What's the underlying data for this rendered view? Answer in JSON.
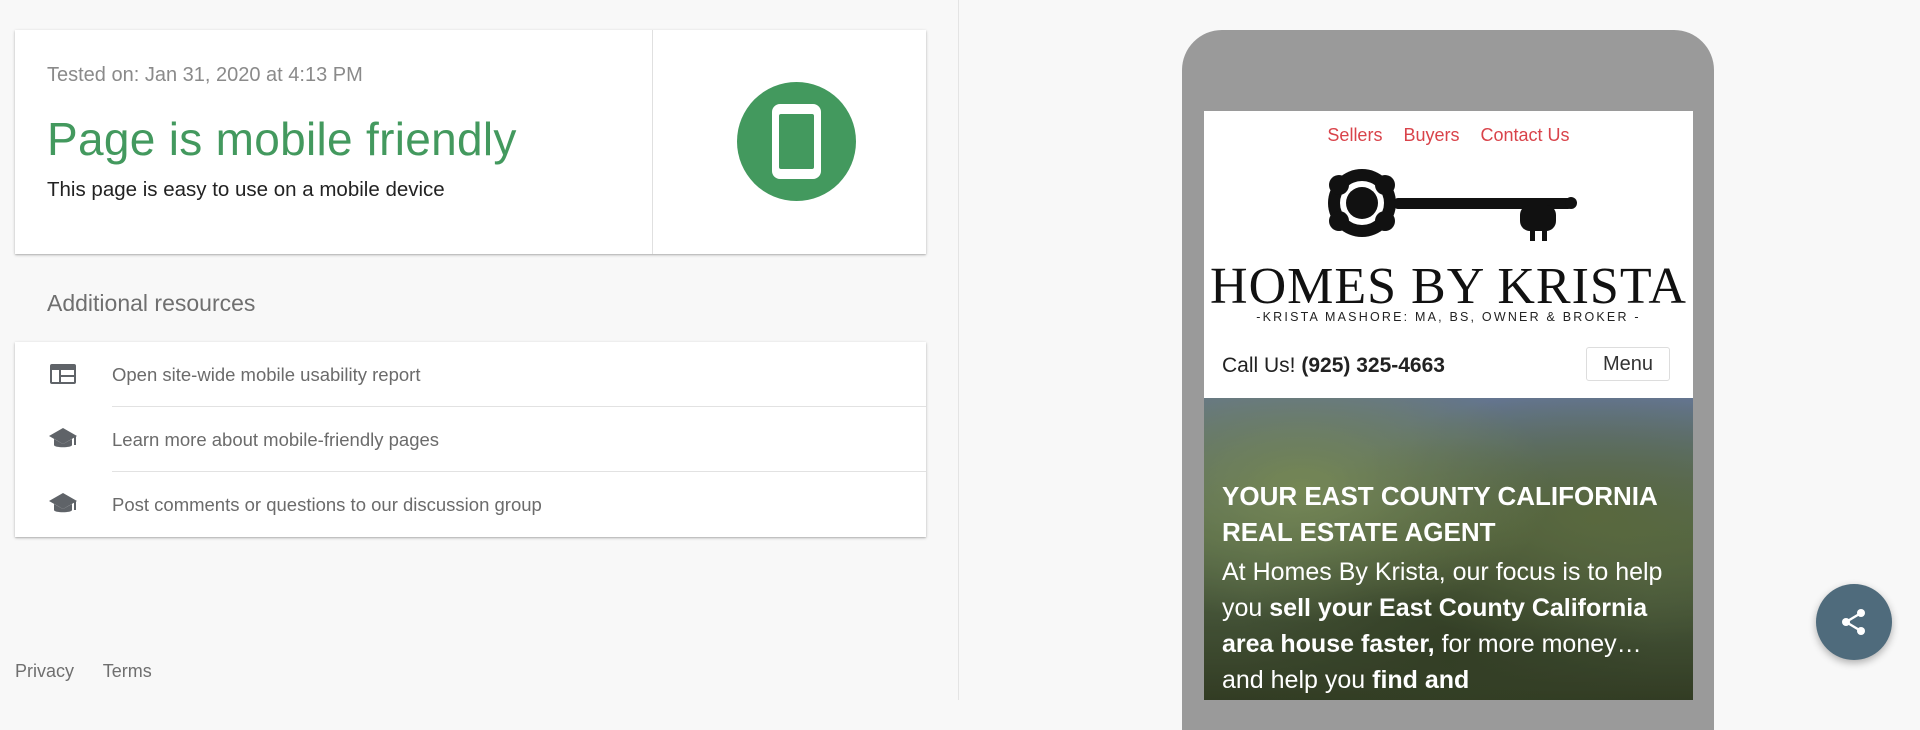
{
  "result": {
    "tested_on": "Tested on: Jan 31, 2020 at 4:13 PM",
    "title": "Page is mobile friendly",
    "description": "This page is easy to use on a mobile device",
    "icon": "mobile-phone-icon",
    "accent_color": "#43995e"
  },
  "resources": {
    "heading": "Additional resources",
    "items": [
      {
        "label": "Open site-wide mobile usability report",
        "icon": "web-layout-icon"
      },
      {
        "label": "Learn more about mobile-friendly pages",
        "icon": "school-icon"
      },
      {
        "label": "Post comments or questions to our discussion group",
        "icon": "school-icon"
      }
    ]
  },
  "footer": {
    "privacy": "Privacy",
    "terms": "Terms"
  },
  "preview": {
    "nav": [
      "Sellers",
      "Buyers",
      "Contact Us"
    ],
    "brand": "HOMES BY KRISTA",
    "tagline": "-KRISTA MASHORE: MA, BS, OWNER & BROKER -",
    "call_prefix": "Call Us!",
    "phone": "(925) 325-4663",
    "menu_label": "Menu",
    "hero_title": "YOUR EAST COUNTY CALIFORNIA REAL ESTATE AGENT",
    "hero_text_1": "At Homes By Krista, our focus is to help you ",
    "hero_text_bold_1": "sell your East County California area house faster,",
    "hero_text_2": " for more money… and help you ",
    "hero_text_bold_2": "find and",
    "nav_color": "#d9434a"
  },
  "share_button": {
    "icon": "share-icon",
    "color": "#4f6b7c"
  }
}
